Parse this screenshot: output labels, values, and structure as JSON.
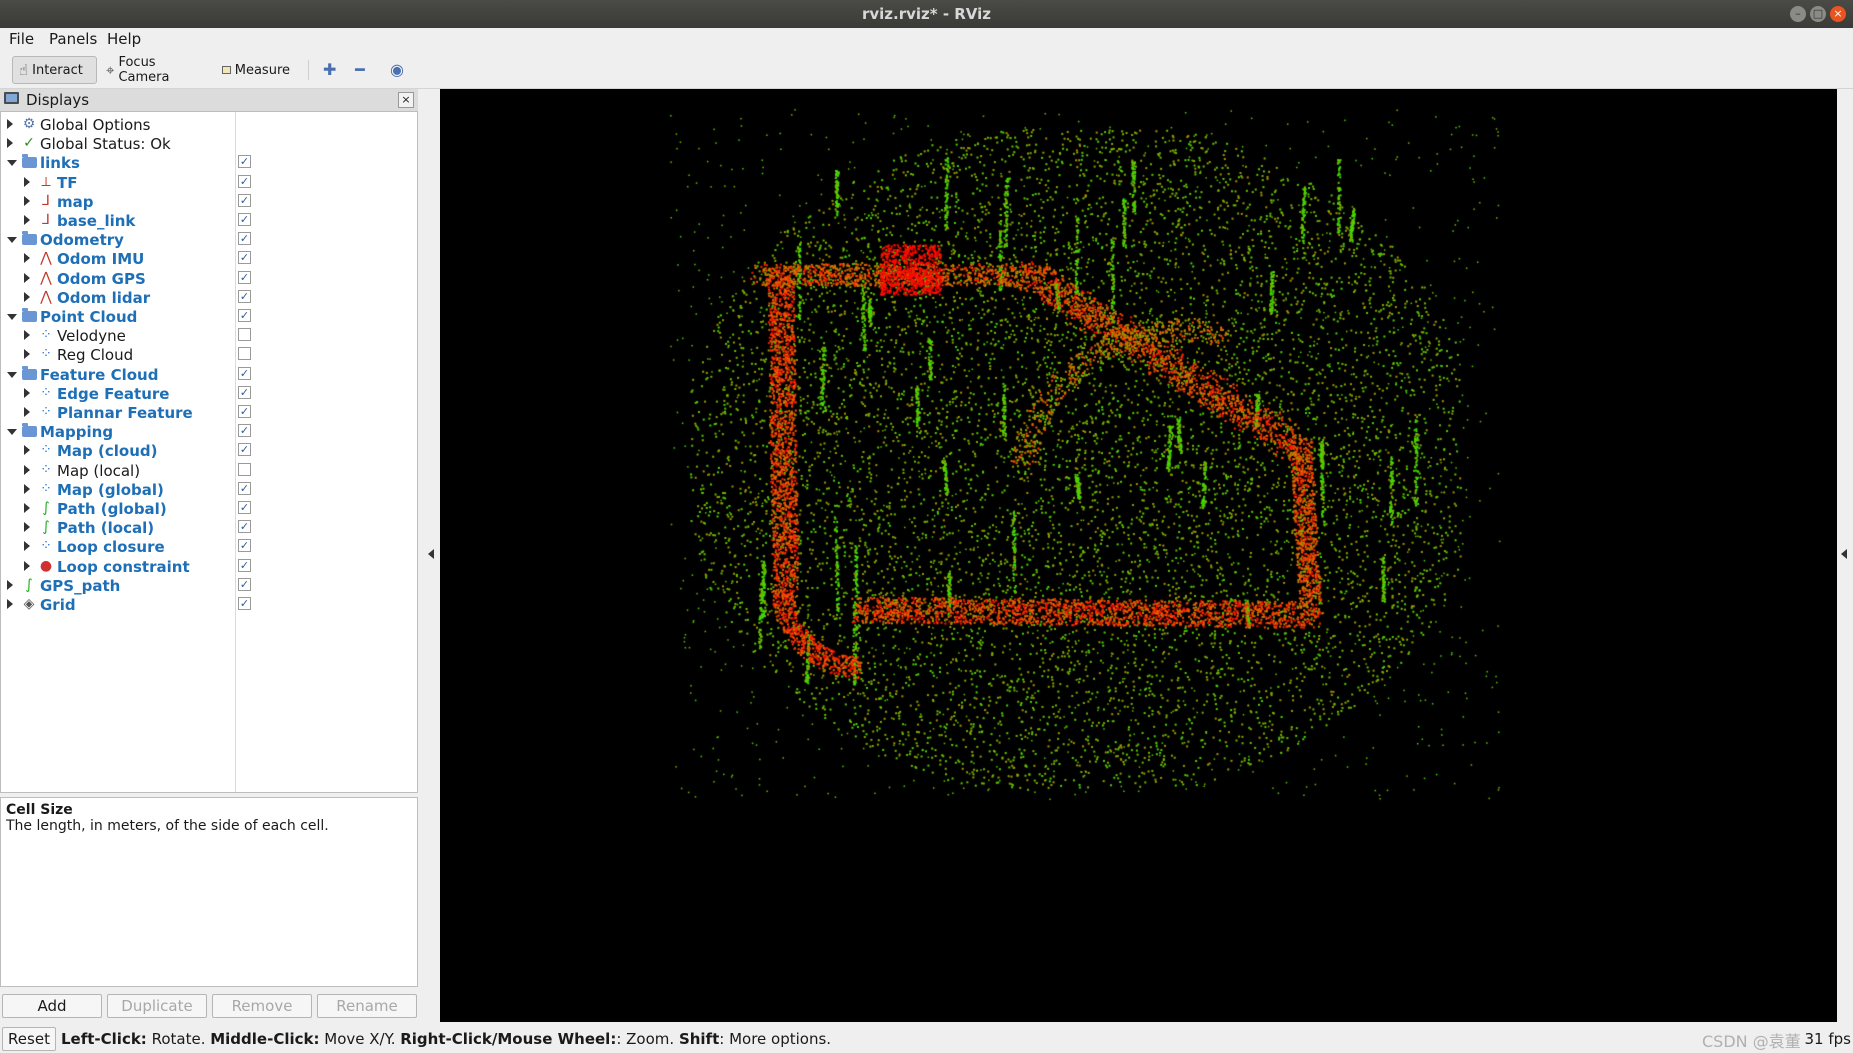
{
  "window": {
    "title": "rviz.rviz* - RViz",
    "min": "–",
    "max": "□",
    "close": "×"
  },
  "menu": {
    "file": "File",
    "panels": "Panels",
    "help": "Help"
  },
  "toolbar": {
    "interact": "Interact",
    "focus_camera": "Focus Camera",
    "measure": "Measure"
  },
  "displays_panel": {
    "title": "Displays",
    "close": "×",
    "rows": [
      {
        "label": "Global Options",
        "depth": 0,
        "expand": "right",
        "icon": "gear-icon",
        "blue": false,
        "checkbox": "none"
      },
      {
        "label": "Global Status: Ok",
        "depth": 0,
        "expand": "right",
        "icon": "check-icon",
        "blue": false,
        "checkbox": "none"
      },
      {
        "label": "links",
        "depth": 0,
        "expand": "down",
        "icon": "folder-icon",
        "blue": true,
        "checkbox": "checked"
      },
      {
        "label": "TF",
        "depth": 1,
        "expand": "right",
        "icon": "tf-axes-icon",
        "blue": true,
        "checkbox": "checked"
      },
      {
        "label": "map",
        "depth": 1,
        "expand": "right",
        "icon": "axes-icon",
        "blue": true,
        "checkbox": "checked"
      },
      {
        "label": "base_link",
        "depth": 1,
        "expand": "right",
        "icon": "axes-icon",
        "blue": true,
        "checkbox": "checked"
      },
      {
        "label": "Odometry",
        "depth": 0,
        "expand": "down",
        "icon": "folder-icon",
        "blue": true,
        "checkbox": "checked"
      },
      {
        "label": "Odom IMU",
        "depth": 1,
        "expand": "right",
        "icon": "odometry-icon",
        "blue": true,
        "checkbox": "checked"
      },
      {
        "label": "Odom GPS",
        "depth": 1,
        "expand": "right",
        "icon": "odometry-icon",
        "blue": true,
        "checkbox": "checked"
      },
      {
        "label": "Odom lidar",
        "depth": 1,
        "expand": "right",
        "icon": "odometry-icon",
        "blue": true,
        "checkbox": "checked"
      },
      {
        "label": "Point Cloud",
        "depth": 0,
        "expand": "down",
        "icon": "folder-icon",
        "blue": true,
        "checkbox": "checked"
      },
      {
        "label": "Velodyne",
        "depth": 1,
        "expand": "right",
        "icon": "pointcloud-icon",
        "blue": false,
        "checkbox": "unchecked"
      },
      {
        "label": "Reg Cloud",
        "depth": 1,
        "expand": "right",
        "icon": "pointcloud-icon",
        "blue": false,
        "checkbox": "unchecked"
      },
      {
        "label": "Feature Cloud",
        "depth": 0,
        "expand": "down",
        "icon": "folder-icon",
        "blue": true,
        "checkbox": "checked"
      },
      {
        "label": "Edge Feature",
        "depth": 1,
        "expand": "right",
        "icon": "pointcloud-icon",
        "blue": true,
        "checkbox": "checked"
      },
      {
        "label": "Plannar Feature",
        "depth": 1,
        "expand": "right",
        "icon": "pointcloud-icon",
        "blue": true,
        "checkbox": "checked"
      },
      {
        "label": "Mapping",
        "depth": 0,
        "expand": "down",
        "icon": "folder-icon",
        "blue": true,
        "checkbox": "checked"
      },
      {
        "label": "Map (cloud)",
        "depth": 1,
        "expand": "right",
        "icon": "pointcloud-icon",
        "blue": true,
        "checkbox": "checked"
      },
      {
        "label": "Map (local)",
        "depth": 1,
        "expand": "right",
        "icon": "pointcloud-icon",
        "blue": false,
        "checkbox": "unchecked"
      },
      {
        "label": "Map (global)",
        "depth": 1,
        "expand": "right",
        "icon": "pointcloud-icon",
        "blue": true,
        "checkbox": "checked"
      },
      {
        "label": "Path (global)",
        "depth": 1,
        "expand": "right",
        "icon": "path-icon",
        "blue": true,
        "checkbox": "checked"
      },
      {
        "label": "Path (local)",
        "depth": 1,
        "expand": "right",
        "icon": "path-icon",
        "blue": true,
        "checkbox": "checked"
      },
      {
        "label": "Loop closure",
        "depth": 1,
        "expand": "right",
        "icon": "pointcloud-icon",
        "blue": true,
        "checkbox": "checked"
      },
      {
        "label": "Loop constraint",
        "depth": 1,
        "expand": "right",
        "icon": "marker-icon",
        "blue": true,
        "checkbox": "checked"
      },
      {
        "label": "GPS_path",
        "depth": 0,
        "expand": "right",
        "icon": "path-icon",
        "blue": true,
        "checkbox": "checked"
      },
      {
        "label": "Grid",
        "depth": 0,
        "expand": "right",
        "icon": "grid-icon",
        "blue": true,
        "checkbox": "checked"
      }
    ]
  },
  "help": {
    "title": "Cell Size",
    "text": "The length, in meters, of the side of each cell."
  },
  "buttons": {
    "add": "Add",
    "duplicate": "Duplicate",
    "remove": "Remove",
    "rename": "Rename"
  },
  "status": {
    "reset": "Reset",
    "hint_parts": [
      {
        "text": "Left-Click:",
        "bold": true
      },
      {
        "text": " Rotate. ",
        "bold": false
      },
      {
        "text": "Middle-Click:",
        "bold": true
      },
      {
        "text": " Move X/Y. ",
        "bold": false
      },
      {
        "text": "Right-Click/Mouse Wheel:",
        "bold": true
      },
      {
        "text": ": Zoom. ",
        "bold": false
      },
      {
        "text": "Shift",
        "bold": true
      },
      {
        "text": ": More options.",
        "bold": false
      }
    ],
    "fps": "31 fps",
    "watermark": "CSDN @袁董"
  },
  "colors": {
    "accent_blue": "#1f6fb7",
    "viewport_bg": "#000000",
    "map_red": "#ff2a00",
    "map_green": "#37d000"
  }
}
